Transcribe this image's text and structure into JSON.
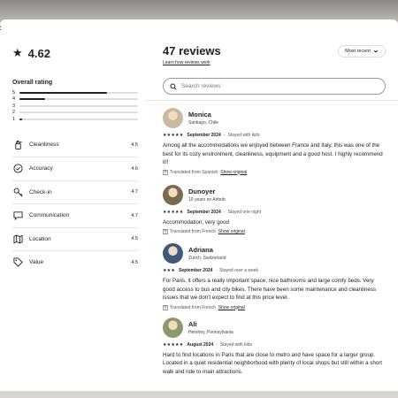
{
  "close_glyph": "‹",
  "summary": {
    "star_icon": "star-icon",
    "score": "4.62",
    "overall_label": "Overall rating",
    "distribution": [
      {
        "stars": "5",
        "fraction": 0.74
      },
      {
        "stars": "4",
        "fraction": 0.22
      },
      {
        "stars": "3",
        "fraction": 0.0
      },
      {
        "stars": "2",
        "fraction": 0.0
      },
      {
        "stars": "1",
        "fraction": 0.02
      }
    ],
    "categories": [
      {
        "icon": "spray-bottle-icon",
        "label": "Cleanliness",
        "value": "4.5"
      },
      {
        "icon": "check-circle-icon",
        "label": "Accuracy",
        "value": "4.6"
      },
      {
        "icon": "key-icon",
        "label": "Check-in",
        "value": "4.7"
      },
      {
        "icon": "chat-bubble-icon",
        "label": "Communication",
        "value": "4.7"
      },
      {
        "icon": "map-icon",
        "label": "Location",
        "value": "4.5"
      },
      {
        "icon": "tag-icon",
        "label": "Value",
        "value": "4.5"
      }
    ]
  },
  "reviews_panel": {
    "title": "47 reviews",
    "learn_link": "Learn how reviews work",
    "sort_label": "Most recent",
    "search_placeholder": "Search reviews"
  },
  "reviews": [
    {
      "name": "Monica",
      "subtitle": "Santiago, Chile",
      "stars": "★★★★★",
      "date": "September 2024",
      "dot": "·",
      "stay": "Stayed with kids",
      "text": "Among all the accommodations we enjoyed between France and Italy, this was one of the best for its cozy environment, cleanliness, equipment and a good host. I highly recommend it!!",
      "translation": "Translated from Spanish",
      "show_original": "Show original",
      "avatar_color": "#c9b9a0"
    },
    {
      "name": "Dunoyer",
      "subtitle": "10 years on Airbnb",
      "stars": "★★★★★",
      "date": "September 2024",
      "dot": "·",
      "stay": "Stayed one night",
      "text": "Accommodation, very good",
      "translation": "Translated from French",
      "show_original": "Show original",
      "avatar_color": "#7a6a4f"
    },
    {
      "name": "Adriana",
      "subtitle": "Zürich, Switzerland",
      "stars": "★★★",
      "date": "September 2024",
      "dot": "·",
      "stay": "Stayed over a week",
      "text": "For Paris, it offers a really important space, nice bathrooms and large comfy beds. Very good access to bus and city bikes. There have been some maintenance and cleanliness issues that we don't expect to find at this price level.",
      "translation": "Translated from French",
      "show_original": "Show original",
      "avatar_color": "#3f5a78"
    },
    {
      "name": "Ali",
      "subtitle": "Hershey, Pennsylvania",
      "stars": "★★★★★",
      "date": "August 2024",
      "dot": "·",
      "stay": "Stayed with kids",
      "text": "Hard to find locations in Paris that are close to metro and have space for a larger group. Located in a quiet residential neighborhood with plenty of local shops but still within a short walk and ride to main attractions.",
      "translation": "",
      "show_original": "",
      "avatar_color": "#8a9a6a"
    }
  ]
}
